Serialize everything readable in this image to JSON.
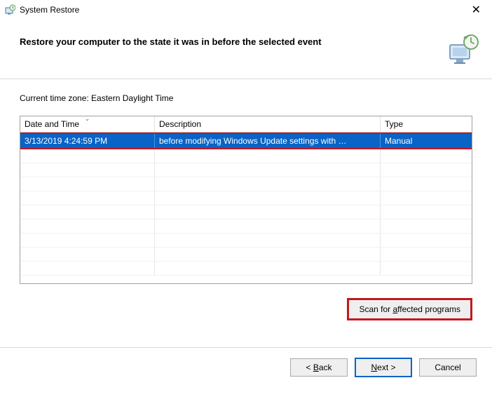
{
  "titlebar": {
    "title": "System Restore"
  },
  "header": {
    "instruction": "Restore your computer to the state it was in before the selected event"
  },
  "timezone": {
    "label": "Current time zone: Eastern Daylight Time"
  },
  "grid": {
    "columns": {
      "datetime": "Date and Time",
      "description": "Description",
      "type": "Type"
    },
    "rows": [
      {
        "datetime": "3/13/2019 4:24:59 PM",
        "description": "before modifying Windows Update settings with …",
        "type": "Manual",
        "selected": true
      }
    ]
  },
  "actions": {
    "scan_prefix": "Scan for ",
    "scan_hotkey": "a",
    "scan_suffix": "ffected programs"
  },
  "footer": {
    "back_prefix": "< ",
    "back_hotkey": "B",
    "back_suffix": "ack",
    "next_hotkey": "N",
    "next_suffix": "ext >",
    "cancel": "Cancel"
  }
}
